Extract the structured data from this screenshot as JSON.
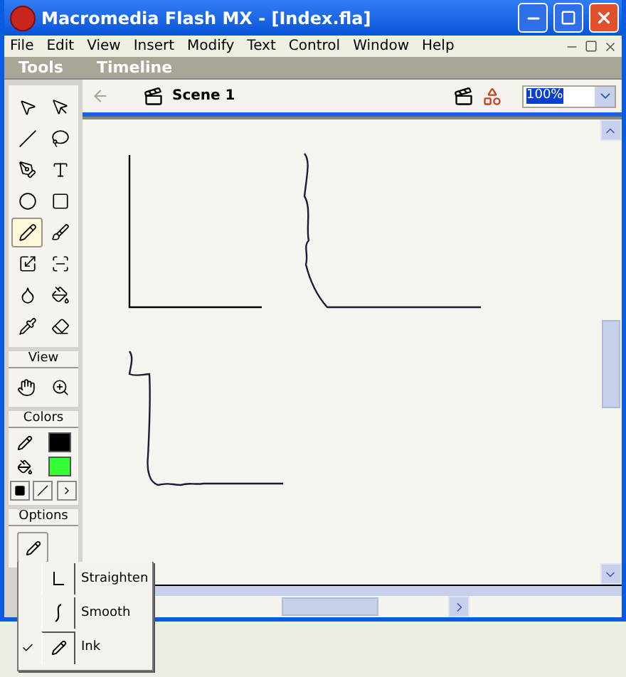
{
  "window": {
    "title": "Macromedia Flash MX - [Index.fla]"
  },
  "menu": [
    "File",
    "Edit",
    "View",
    "Insert",
    "Modify",
    "Text",
    "Control",
    "Window",
    "Help"
  ],
  "tools_panel": {
    "title": "Tools",
    "tools": [
      {
        "kind": "arrow",
        "selected": false
      },
      {
        "kind": "subselect",
        "selected": false
      },
      {
        "kind": "line",
        "selected": false
      },
      {
        "kind": "lasso",
        "selected": false
      },
      {
        "kind": "pen",
        "selected": false
      },
      {
        "kind": "text",
        "selected": false
      },
      {
        "kind": "oval",
        "selected": false
      },
      {
        "kind": "rectangle",
        "selected": false
      },
      {
        "kind": "pencil",
        "selected": true
      },
      {
        "kind": "brush",
        "selected": false
      },
      {
        "kind": "transform",
        "selected": false
      },
      {
        "kind": "fill-transform",
        "selected": false
      },
      {
        "kind": "ink-bottle",
        "selected": false
      },
      {
        "kind": "bucket",
        "selected": false
      },
      {
        "kind": "dropper",
        "selected": false
      },
      {
        "kind": "eraser",
        "selected": false
      }
    ],
    "view_label": "View",
    "view_tools": [
      {
        "kind": "hand"
      },
      {
        "kind": "zoom"
      }
    ],
    "colors_label": "Colors",
    "stroke": {
      "color": "#000000"
    },
    "fill": {
      "color": "#33ff33"
    },
    "options_label": "Options"
  },
  "timeline": {
    "title": "Timeline",
    "scene": "Scene 1",
    "zoom": "100%"
  },
  "pencil_mode_menu": [
    {
      "label": "Straighten",
      "checked": false
    },
    {
      "label": "Smooth",
      "checked": false
    },
    {
      "label": "Ink",
      "checked": true
    }
  ]
}
